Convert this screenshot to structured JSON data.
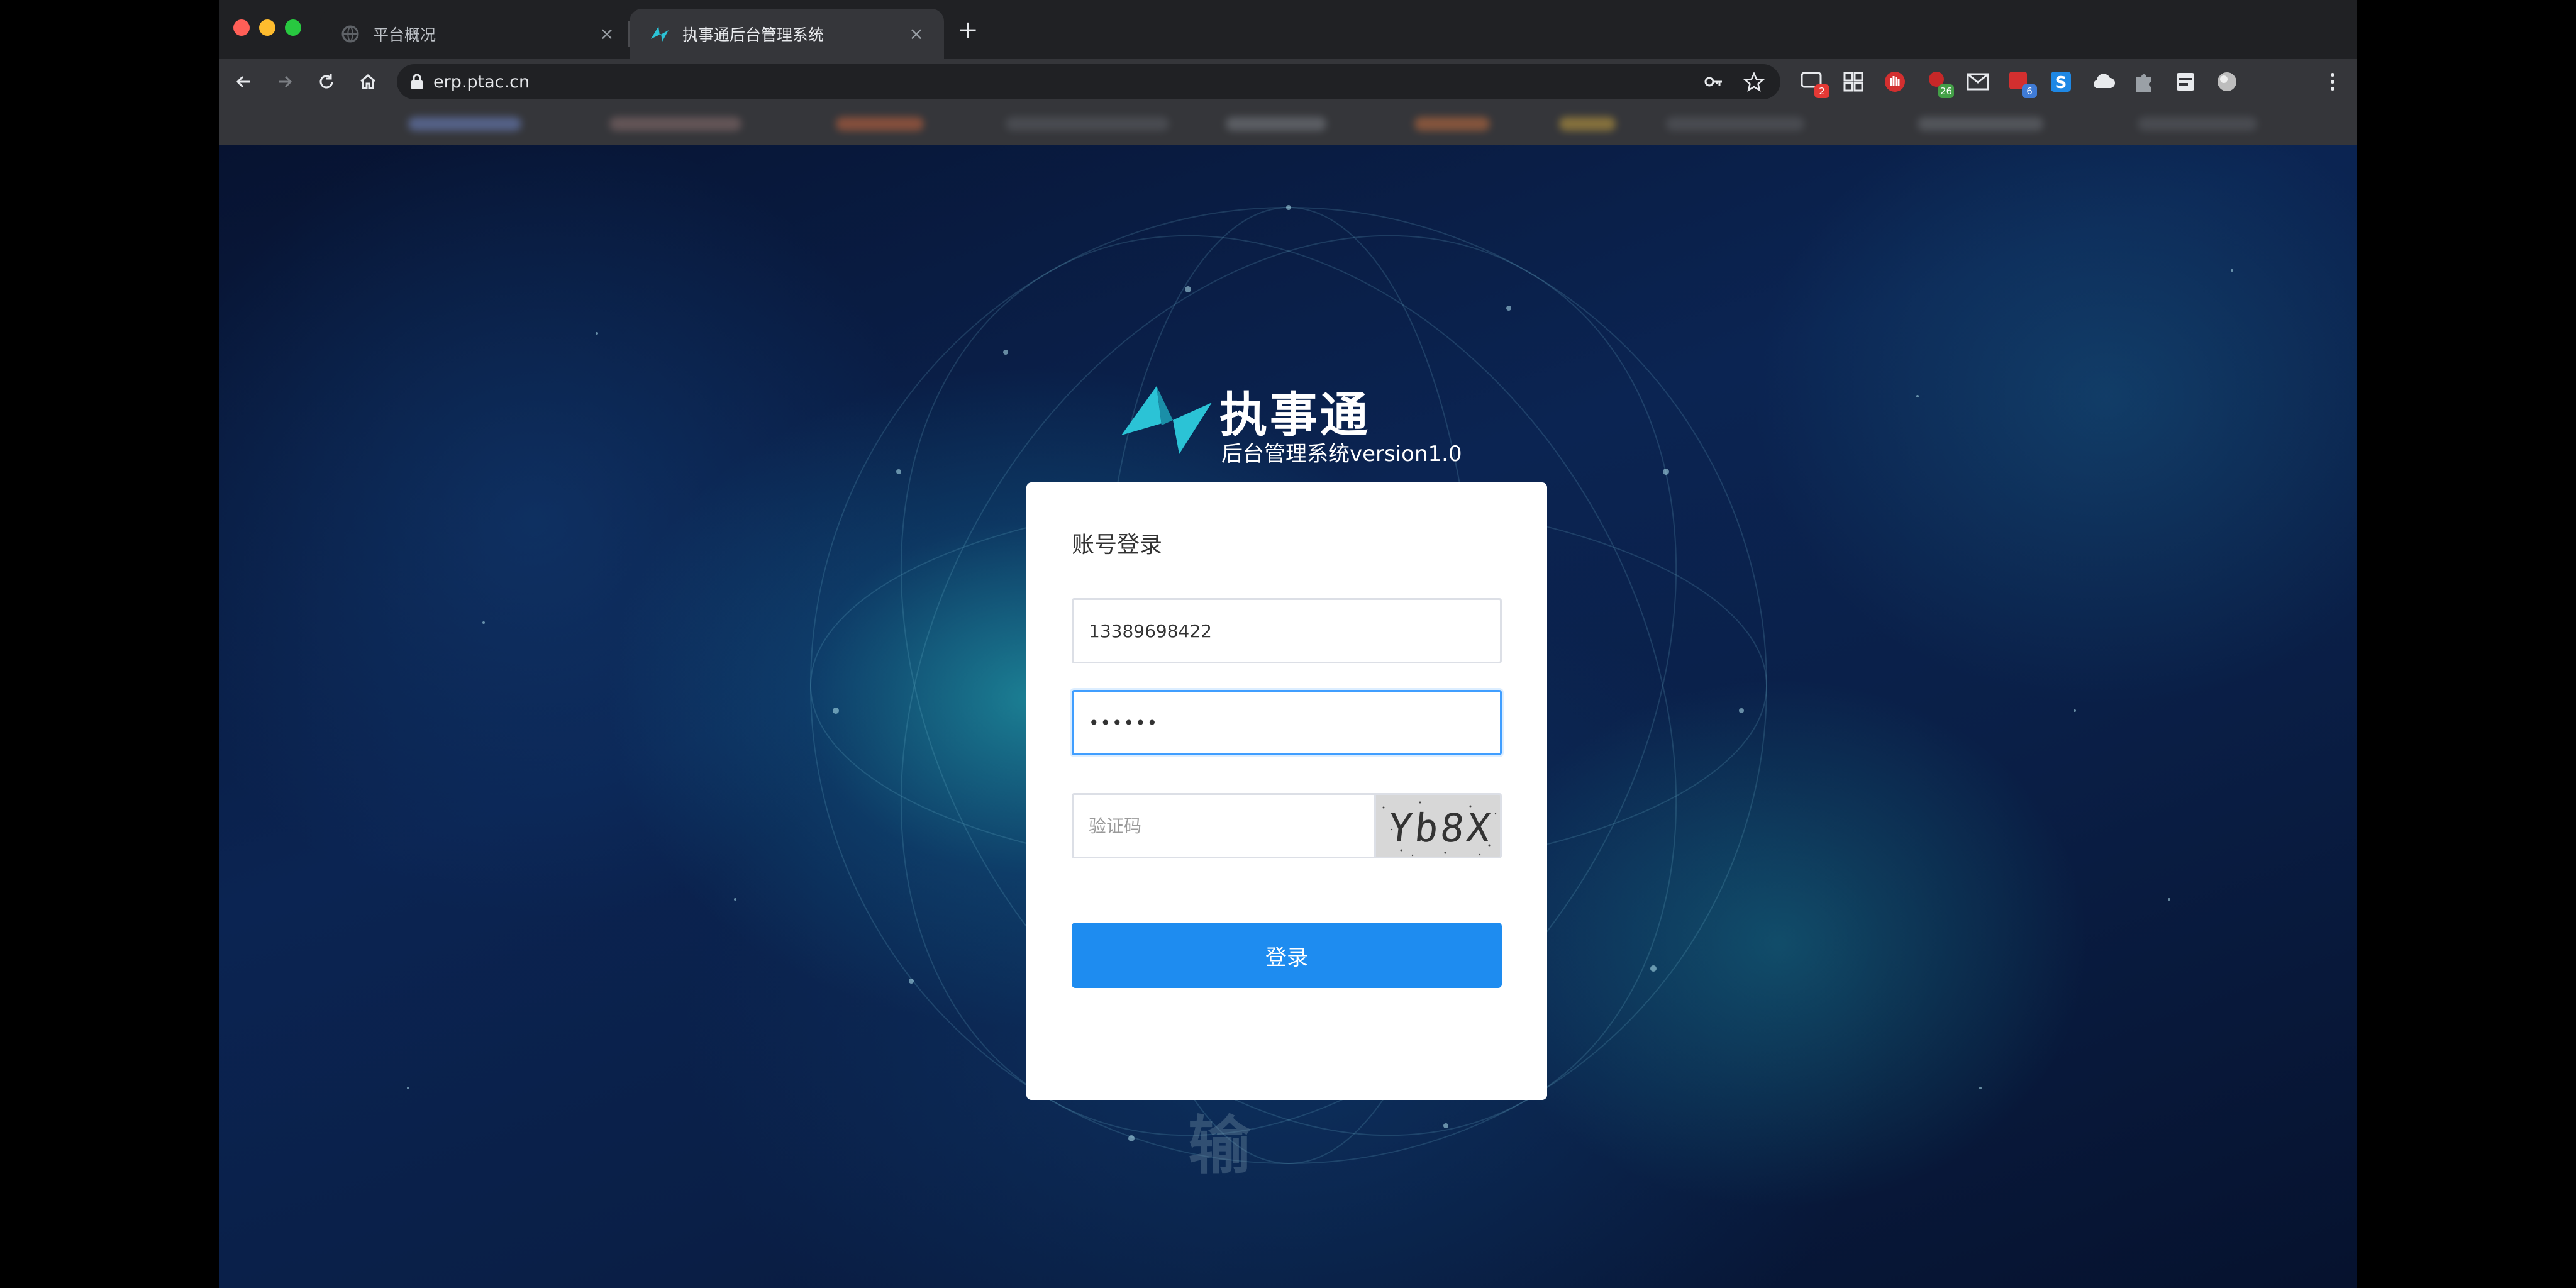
{
  "browser": {
    "tabs": [
      {
        "title": "平台概况",
        "active": false
      },
      {
        "title": "执事通后台管理系统",
        "active": true
      }
    ],
    "url": "erp.ptac.cn",
    "extensions": [
      {
        "icon": "message-icon",
        "badge": "2",
        "badge_color": "#e53935"
      },
      {
        "icon": "grid-icon",
        "badge": ""
      },
      {
        "icon": "stop-hand-icon",
        "badge": ""
      },
      {
        "icon": "bell-icon",
        "badge": "26",
        "badge_color": "#43a047"
      },
      {
        "icon": "mail-icon",
        "badge": "",
        "badge_color": "#9e9e9e"
      },
      {
        "icon": "translate-icon",
        "badge": "6",
        "badge_color": "#3f7bd6"
      },
      {
        "icon": "s-icon",
        "badge": ""
      },
      {
        "icon": "cloud-icon",
        "badge": ""
      },
      {
        "icon": "puzzle-icon",
        "badge": ""
      },
      {
        "icon": "ticket-icon",
        "badge": ""
      },
      {
        "icon": "globe-icon",
        "badge": ""
      }
    ]
  },
  "brand": {
    "name": "执事通",
    "subtitle": "后台管理系统version1.0",
    "accent_color": "#2bc3d6"
  },
  "login": {
    "title": "账号登录",
    "account_value": "13389698422",
    "password_value": "••••••",
    "captcha_placeholder": "验证码",
    "captcha_text": "Yb8X",
    "submit_label": "登录",
    "button_color": "#1e8cf0"
  },
  "background": {
    "watermark_char": "输"
  }
}
